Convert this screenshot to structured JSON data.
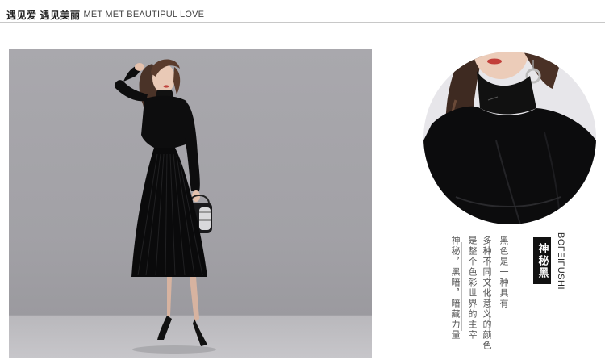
{
  "header": {
    "cn_part1": "遇见爱",
    "cn_part2": "遇见美丽",
    "en": "MET MET BEAUTIPUL LOVE"
  },
  "product": {
    "title": "神秘黑",
    "brand": "BOFEIFUSHI",
    "desc_col1": "黑色是一种具有",
    "desc_col2": "多种不同文化意义的颜色",
    "desc_col3": "是整个色彩世界的主宰",
    "desc_col4": "神秘，黑暗，暗藏力量"
  },
  "colors": {
    "backdrop": "#a5a4a9",
    "dress": "#0b0b0c",
    "title_bg": "#111111"
  }
}
